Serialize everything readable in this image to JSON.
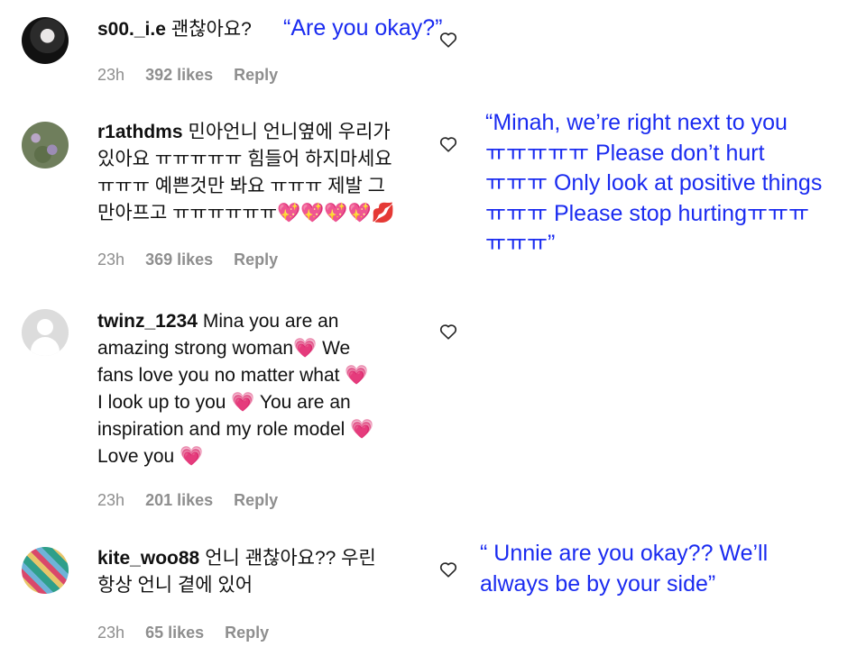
{
  "comments": [
    {
      "username": "s00._i.e",
      "text": "괜찮아요?",
      "time": "23h",
      "likes": "392 likes",
      "reply": "Reply",
      "translation": "“Are you okay?”",
      "avatar_icon": "profile-photo"
    },
    {
      "username": "r1athdms",
      "text": "민아언니 언니옆에 우리가\n있아요 ㅠㅠㅠㅠㅠ 힘들어 하지마세요\nㅠㅠㅠ 예쁜것만 봐요 ㅠㅠㅠ 제발 그\n만아프고 ㅠㅠㅠㅠㅠㅠ💖💖💖💖💋",
      "time": "23h",
      "likes": "369 likes",
      "reply": "Reply",
      "translation": "“Minah, we’re right next to you\nㅠㅠㅠㅠㅠ Please don’t hurt\nㅠㅠㅠ Only look at positive things\nㅠㅠㅠ Please stop hurtingㅠㅠㅠ\nㅠㅠㅠ”",
      "avatar_icon": "flower-photo"
    },
    {
      "username": "twinz_1234",
      "text": "Mina you are an\namazing strong woman💗 We\nfans love you no matter what 💗\nI look up to you 💗 You are an\ninspiration and my role model 💗\nLove you 💗",
      "time": "23h",
      "likes": "201 likes",
      "reply": "Reply",
      "avatar_icon": "default-avatar"
    },
    {
      "username": "kite_woo88",
      "text": "언니 괜찮아요?? 우린\n항상 언니 곁에 있어",
      "time": "23h",
      "likes": "65 likes",
      "reply": "Reply",
      "translation": "“ Unnie are you okay?? We’ll\nalways be by your side”",
      "avatar_icon": "pattern-photo"
    }
  ],
  "colors": {
    "translation": "#1a2bf0",
    "meta": "#8e8e8e",
    "text": "#111111"
  },
  "icons": {
    "like": "heart-outline-icon"
  }
}
